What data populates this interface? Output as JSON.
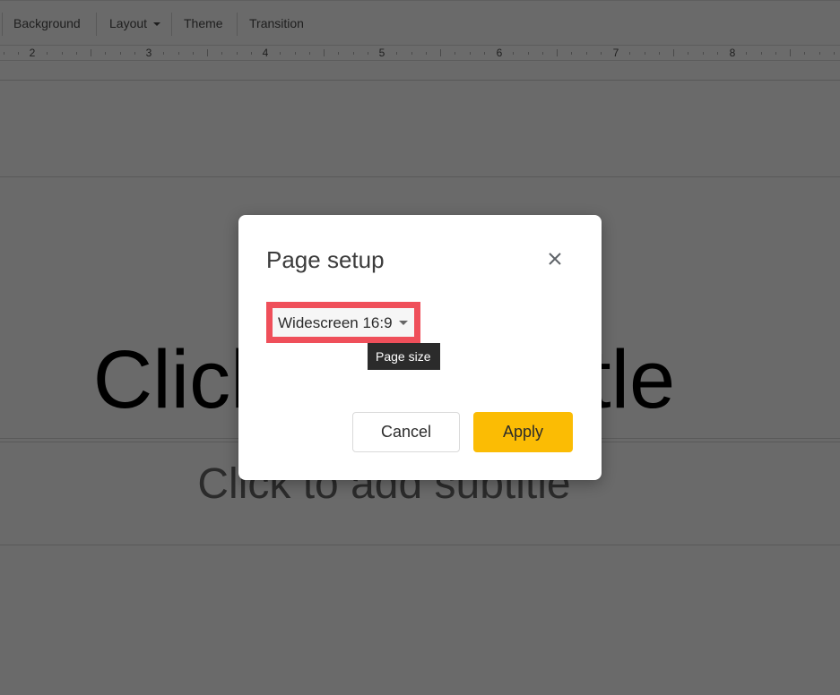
{
  "toolbar": {
    "items": [
      "Background",
      "Layout",
      "Theme",
      "Transition"
    ]
  },
  "ruler": {
    "labels": [
      "2",
      "3",
      "4",
      "5",
      "6",
      "7",
      "8"
    ]
  },
  "slide": {
    "title_placeholder": "Click to add title",
    "subtitle_placeholder": "Click to add subtitle"
  },
  "dialog": {
    "title": "Page setup",
    "page_size_value": "Widescreen 16:9",
    "tooltip": "Page size",
    "cancel_label": "Cancel",
    "apply_label": "Apply",
    "highlight_color": "#ef4f5a",
    "apply_color": "#fbbc04"
  }
}
